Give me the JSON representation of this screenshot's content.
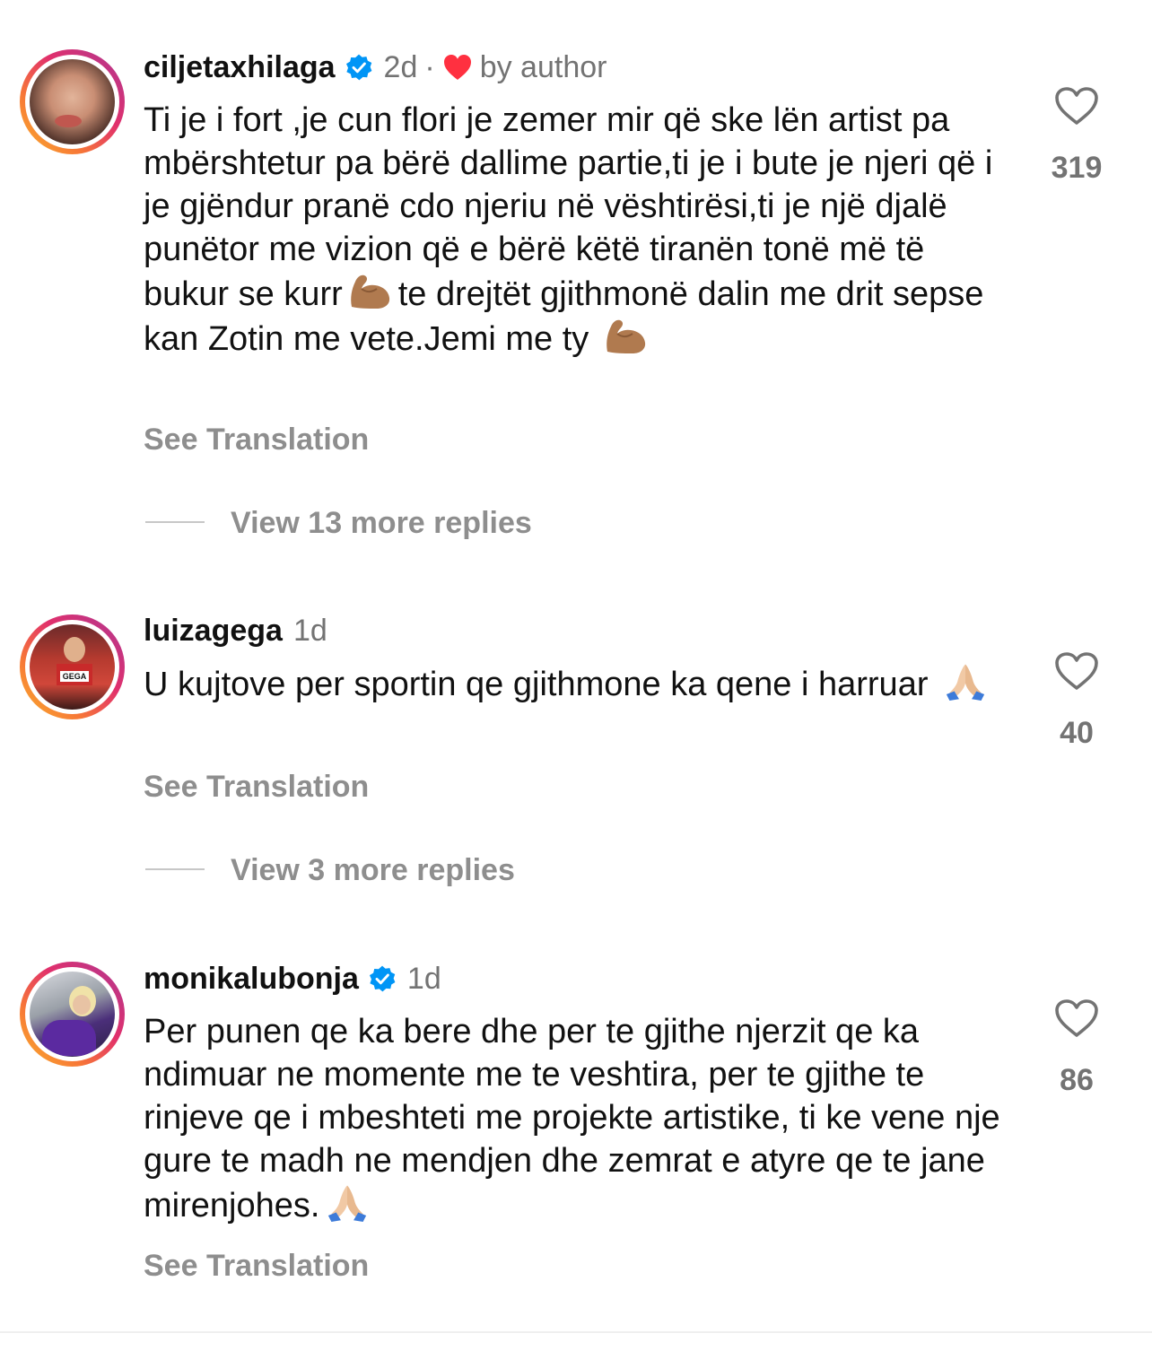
{
  "comments": [
    {
      "username": "ciljetaxhilaga",
      "verified": true,
      "time": "2d",
      "separator": "·",
      "liked_by_author": "by author",
      "text_parts": [
        "Ti je i fort ,je cun flori je zemer mir që ske lën artist pa mbërshtetur pa bërë dallime partie,ti je i bute je njeri që i je gjëndur pranë cdo njeriu në vështirësi,ti je një djalë punëtor me vizion që e bërë  këtë tiranën tonë më të bukur se kurr",
        "te drejtët gjithmonë dalin me drit sepse kan Zotin me vete.Jemi me ty "
      ],
      "emojis": [
        "flexed-biceps-icon",
        "flexed-biceps-icon"
      ],
      "see_translation": "See Translation",
      "view_replies": "View 13 more replies",
      "likes": "319"
    },
    {
      "username": "luizagega",
      "verified": false,
      "time": "1d",
      "text_parts": [
        "U kujtove per sportin qe gjithmone ka qene i harruar "
      ],
      "emojis": [
        "folded-hands-icon"
      ],
      "see_translation": "See Translation",
      "view_replies": "View 3 more replies",
      "likes": "40",
      "avatar_badge": "GEGA"
    },
    {
      "username": "monikalubonja",
      "verified": true,
      "time": "1d",
      "text_parts": [
        "Per punen qe ka bere dhe per te gjithe njerzit qe ka ndimuar ne momente me te veshtira, per te gjithe te rinjeve qe i mbeshteti me projekte artistike, ti ke vene nje gure te madh ne  mendjen dhe zemrat e atyre qe te jane mirenjohes."
      ],
      "emojis": [
        "folded-hands-icon"
      ],
      "see_translation": "See Translation",
      "likes": "86"
    }
  ],
  "colors": {
    "verified": "#0095f6",
    "heart_red": "#ff3040",
    "muted": "#737373",
    "secondary": "#8e8e8e"
  }
}
